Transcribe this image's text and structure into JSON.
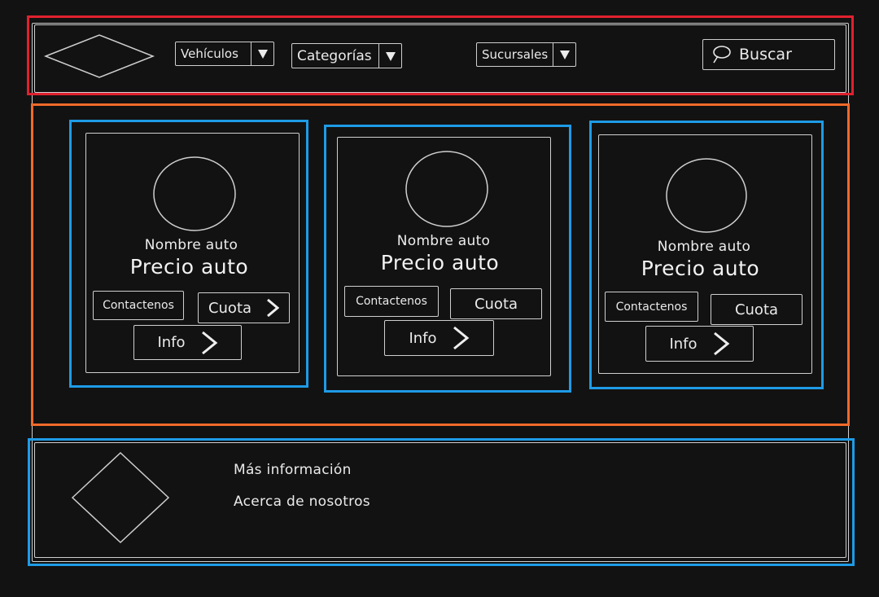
{
  "header": {
    "nav": [
      {
        "label": "Vehículos"
      },
      {
        "label": "Categorías"
      },
      {
        "label": "Sucursales"
      }
    ],
    "search_label": "Buscar"
  },
  "cards": [
    {
      "name": "Nombre auto",
      "price": "Precio auto",
      "contact": "Contactenos",
      "quota": "Cuota",
      "info": "Info"
    },
    {
      "name": "Nombre auto",
      "price": "Precio auto",
      "contact": "Contactenos",
      "quota": "Cuota",
      "info": "Info"
    },
    {
      "name": "Nombre auto",
      "price": "Precio auto",
      "contact": "Contactenos",
      "quota": "Cuota",
      "info": "Info"
    }
  ],
  "footer": {
    "links": [
      "Más información",
      "Acerca de nosotros"
    ]
  },
  "colors": {
    "background": "#121212",
    "sketch_stroke": "#cfcfcf",
    "annotation_header": "#e0212e",
    "annotation_main": "#f06a2a",
    "annotation_blue": "#1e9be6"
  }
}
